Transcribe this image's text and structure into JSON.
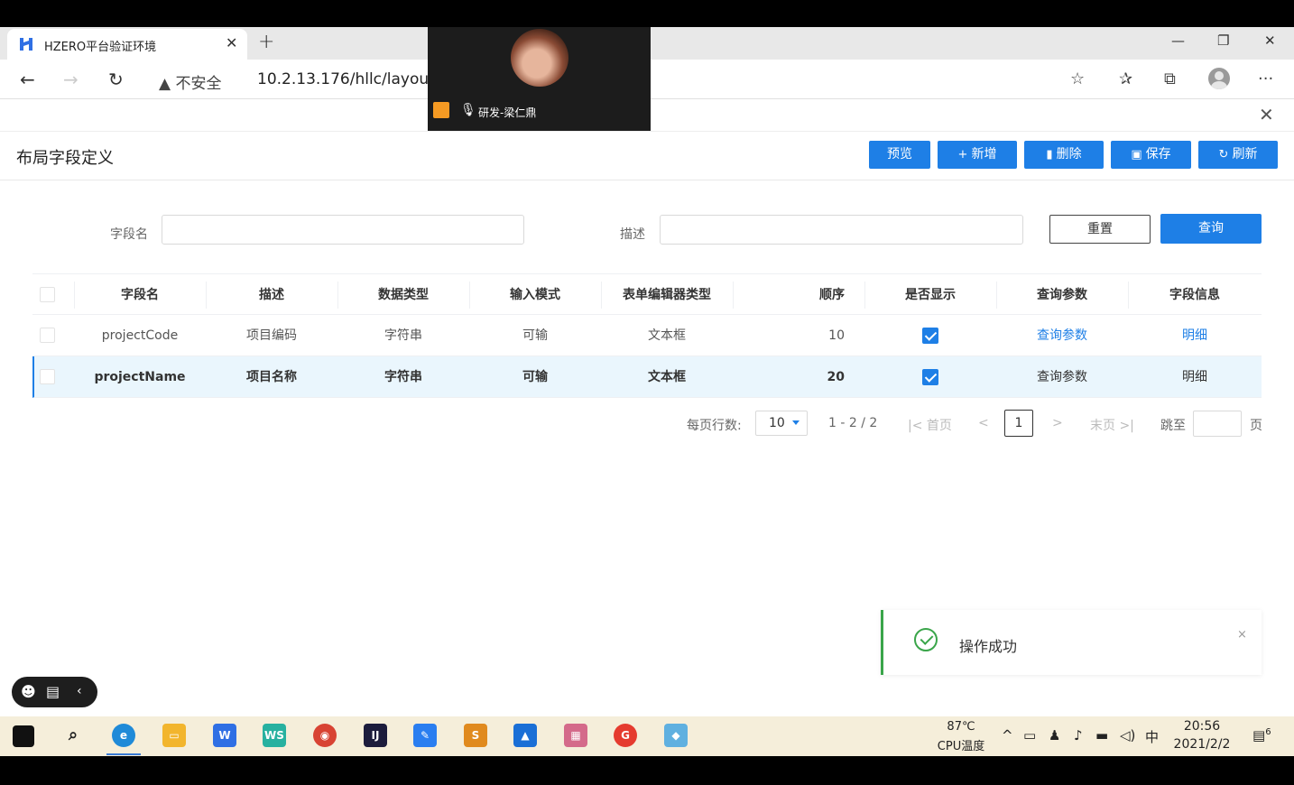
{
  "browser": {
    "tab_title": "HZERO平台验证环境",
    "tab_close": "✕",
    "new_tab": "+",
    "security_label": "不安全",
    "url": "10.2.13.176/hllc/layout/l",
    "win_minimize": "—",
    "win_maximize": "❐",
    "win_close": "✕"
  },
  "video_call": {
    "participant": "研发-梁仁鼎"
  },
  "page": {
    "title": "布局字段定义",
    "close": "✕",
    "toolbar": {
      "preview": "预览",
      "add": "新增",
      "delete": "删除",
      "save": "保存",
      "refresh": "刷新"
    },
    "query_form": {
      "field_name_label": "字段名",
      "field_name_value": "",
      "description_label": "描述",
      "description_value": "",
      "reset": "重置",
      "query": "查询"
    },
    "table": {
      "columns": [
        "字段名",
        "描述",
        "数据类型",
        "输入模式",
        "表单编辑器类型",
        "顺序",
        "是否显示",
        "查询参数",
        "字段信息"
      ],
      "rows": [
        {
          "field_name": "projectCode",
          "description": "项目编码",
          "data_type": "字符串",
          "input_mode": "可输",
          "editor_type": "文本框",
          "order": "10",
          "visible": true,
          "query_params": "查询参数",
          "field_info": "明细",
          "selected": false
        },
        {
          "field_name": "projectName",
          "description": "项目名称",
          "data_type": "字符串",
          "input_mode": "可输",
          "editor_type": "文本框",
          "order": "20",
          "visible": true,
          "query_params": "查询参数",
          "field_info": "明细",
          "selected": true
        }
      ]
    },
    "pagination": {
      "rows_per_page_label": "每页行数:",
      "rows_per_page": "10",
      "range": "1 - 2 / 2",
      "first": "首页",
      "prev": "<",
      "current_page": "1",
      "next": ">",
      "last": "末页",
      "jump_label": "跳至",
      "page_unit": "页"
    },
    "toast": {
      "message": "操作成功",
      "close": "×"
    }
  },
  "taskbar": {
    "cpu_temp": "87℃",
    "cpu_label": "CPU温度",
    "ime": "中",
    "time": "20:56",
    "date": "2021/2/2",
    "notifications": "6"
  },
  "colors": {
    "primary": "#1e7fe6",
    "success": "#3aa54a"
  }
}
